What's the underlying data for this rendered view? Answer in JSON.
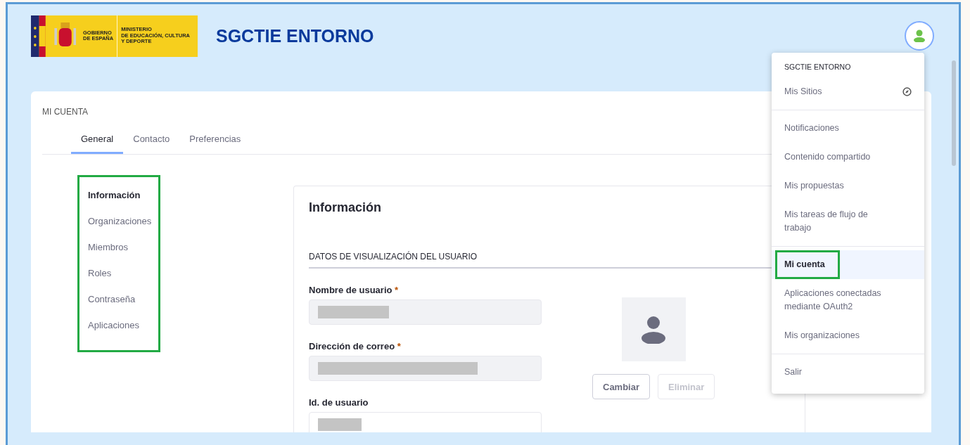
{
  "header": {
    "logo": {
      "gobierno_lines": [
        "GOBIERNO",
        "DE ESPAÑA"
      ],
      "ministerio_lines": [
        "MINISTERIO",
        "DE EDUCACIÓN, CULTURA",
        "Y DEPORTE"
      ]
    },
    "title": "SGCTIE ENTORNO"
  },
  "account": {
    "title": "MI CUENTA",
    "tabs": [
      {
        "label": "General",
        "selected": true
      },
      {
        "label": "Contacto",
        "selected": false
      },
      {
        "label": "Preferencias",
        "selected": false
      }
    ],
    "sidebar": {
      "highlighted": true,
      "items": [
        {
          "label": "Información",
          "selected": true
        },
        {
          "label": "Organizaciones",
          "selected": false
        },
        {
          "label": "Miembros",
          "selected": false
        },
        {
          "label": "Roles",
          "selected": false
        },
        {
          "label": "Contraseña",
          "selected": false
        },
        {
          "label": "Aplicaciones",
          "selected": false
        }
      ]
    },
    "panel": {
      "title": "Información",
      "section_title": "DATOS DE VISUALIZACIÓN DEL USUARIO",
      "fields": [
        {
          "label": "Nombre de usuario",
          "required_mark": "*",
          "disabled": true,
          "redacted": true
        },
        {
          "label": "Dirección de correo",
          "required_mark": "*",
          "disabled": true,
          "redacted": true
        },
        {
          "label": "Id. de usuario",
          "disabled": false,
          "redacted": true
        }
      ],
      "photo_buttons": [
        {
          "label": "Cambiar",
          "disabled": false
        },
        {
          "label": "Eliminar",
          "disabled": true
        }
      ]
    }
  },
  "user_menu": {
    "open": true,
    "site_name": "SGCTIE ENTORNO",
    "sections": [
      [
        {
          "label": "Mis Sitios",
          "kind": "sites",
          "selected": false,
          "highlighted": false
        }
      ],
      [
        {
          "label": "Notificaciones",
          "kind": "link",
          "selected": false,
          "highlighted": false
        },
        {
          "label": "Contenido compartido",
          "kind": "link",
          "selected": false,
          "highlighted": false
        },
        {
          "label": "Mis propuestas",
          "kind": "link",
          "selected": false,
          "highlighted": false
        },
        {
          "label": "Mis tareas de flujo de trabajo",
          "kind": "link",
          "selected": false,
          "highlighted": false
        }
      ],
      [
        {
          "label": "Mi cuenta",
          "kind": "link",
          "selected": true,
          "highlighted": true
        },
        {
          "label": "Aplicaciones conectadas mediante OAuth2",
          "kind": "link",
          "selected": false,
          "highlighted": false
        },
        {
          "label": "Mis organizaciones",
          "kind": "link",
          "selected": false,
          "highlighted": false
        }
      ],
      [
        {
          "label": "Salir",
          "kind": "link",
          "selected": false,
          "highlighted": false
        }
      ]
    ]
  }
}
